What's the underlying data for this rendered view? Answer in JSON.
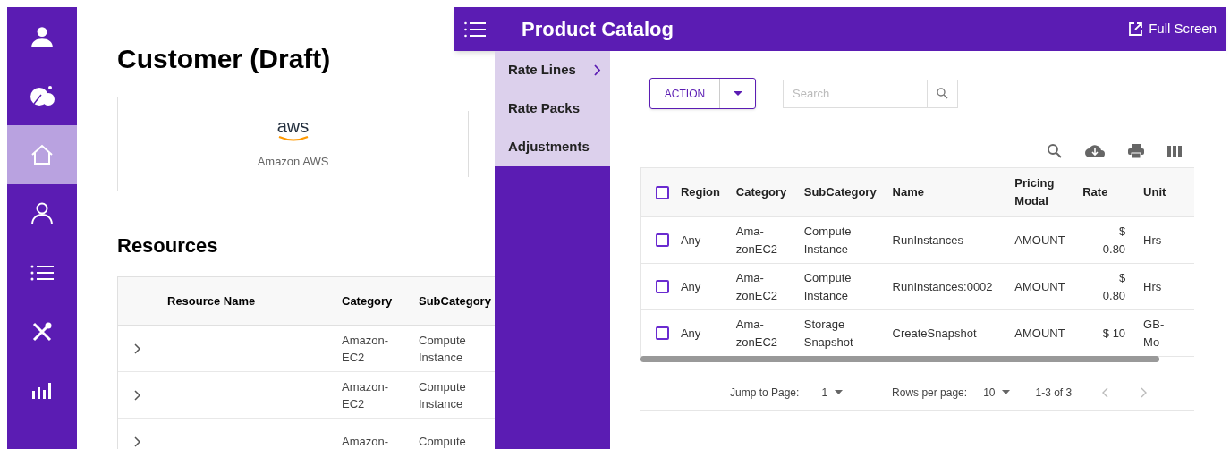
{
  "sidebar": {
    "items": [
      {
        "kind": "profile",
        "selected": false
      },
      {
        "kind": "logo",
        "selected": false
      },
      {
        "kind": "home",
        "selected": true
      },
      {
        "kind": "user",
        "selected": false
      },
      {
        "kind": "list",
        "selected": false
      },
      {
        "kind": "tools",
        "selected": false
      },
      {
        "kind": "chart",
        "selected": false
      }
    ]
  },
  "page": {
    "title": "Customer (Draft)",
    "provider_card": {
      "logo": "aws",
      "name": "Amazon AWS"
    },
    "section_title": "Resources",
    "resources_table": {
      "columns": [
        "Resource Name",
        "Category",
        "SubCategory"
      ],
      "rows": [
        {
          "expanded": false,
          "cells": [
            "",
            "Amazon-EC2",
            "Compute Instance"
          ]
        },
        {
          "expanded": false,
          "cells": [
            "",
            "Amazon-EC2",
            "Compute Instance"
          ]
        },
        {
          "expanded": false,
          "cells": [
            "",
            "Amazon-",
            "Compute"
          ]
        }
      ]
    }
  },
  "panel": {
    "title": "Product Catalog",
    "full_screen": "Full Screen",
    "menu": [
      {
        "label": "Rate Lines",
        "submenu": true
      },
      {
        "label": "Rate Packs",
        "submenu": false
      },
      {
        "label": "Adjustments",
        "submenu": false
      }
    ],
    "action_button": "ACTION",
    "search": {
      "placeholder": "Search"
    },
    "table": {
      "columns": [
        "Region",
        "Category",
        "SubCategory",
        "Name",
        "Pricing Modal",
        "Rate",
        "Unit"
      ],
      "header_checked": false,
      "rows": [
        {
          "checked": false,
          "cells": [
            "Any",
            "Ama-zonEC2",
            "Compute Instance",
            "RunInstances",
            "AMOUNT",
            "$ 0.80",
            "Hrs"
          ]
        },
        {
          "checked": false,
          "cells": [
            "Any",
            "Ama-zonEC2",
            "Compute Instance",
            "RunInstances:0002",
            "AMOUNT",
            "$ 0.80",
            "Hrs"
          ]
        },
        {
          "checked": false,
          "cells": [
            "Any",
            "Ama-zonEC2",
            "Storage Snapshot",
            "CreateSnapshot",
            "AMOUNT",
            "$ 10",
            "GB-Mo"
          ]
        }
      ]
    },
    "pagination": {
      "jump_label": "Jump to Page:",
      "page": "1",
      "rows_label": "Rows per page:",
      "rows_per_page": "10",
      "range": "1-3 of 3"
    }
  }
}
